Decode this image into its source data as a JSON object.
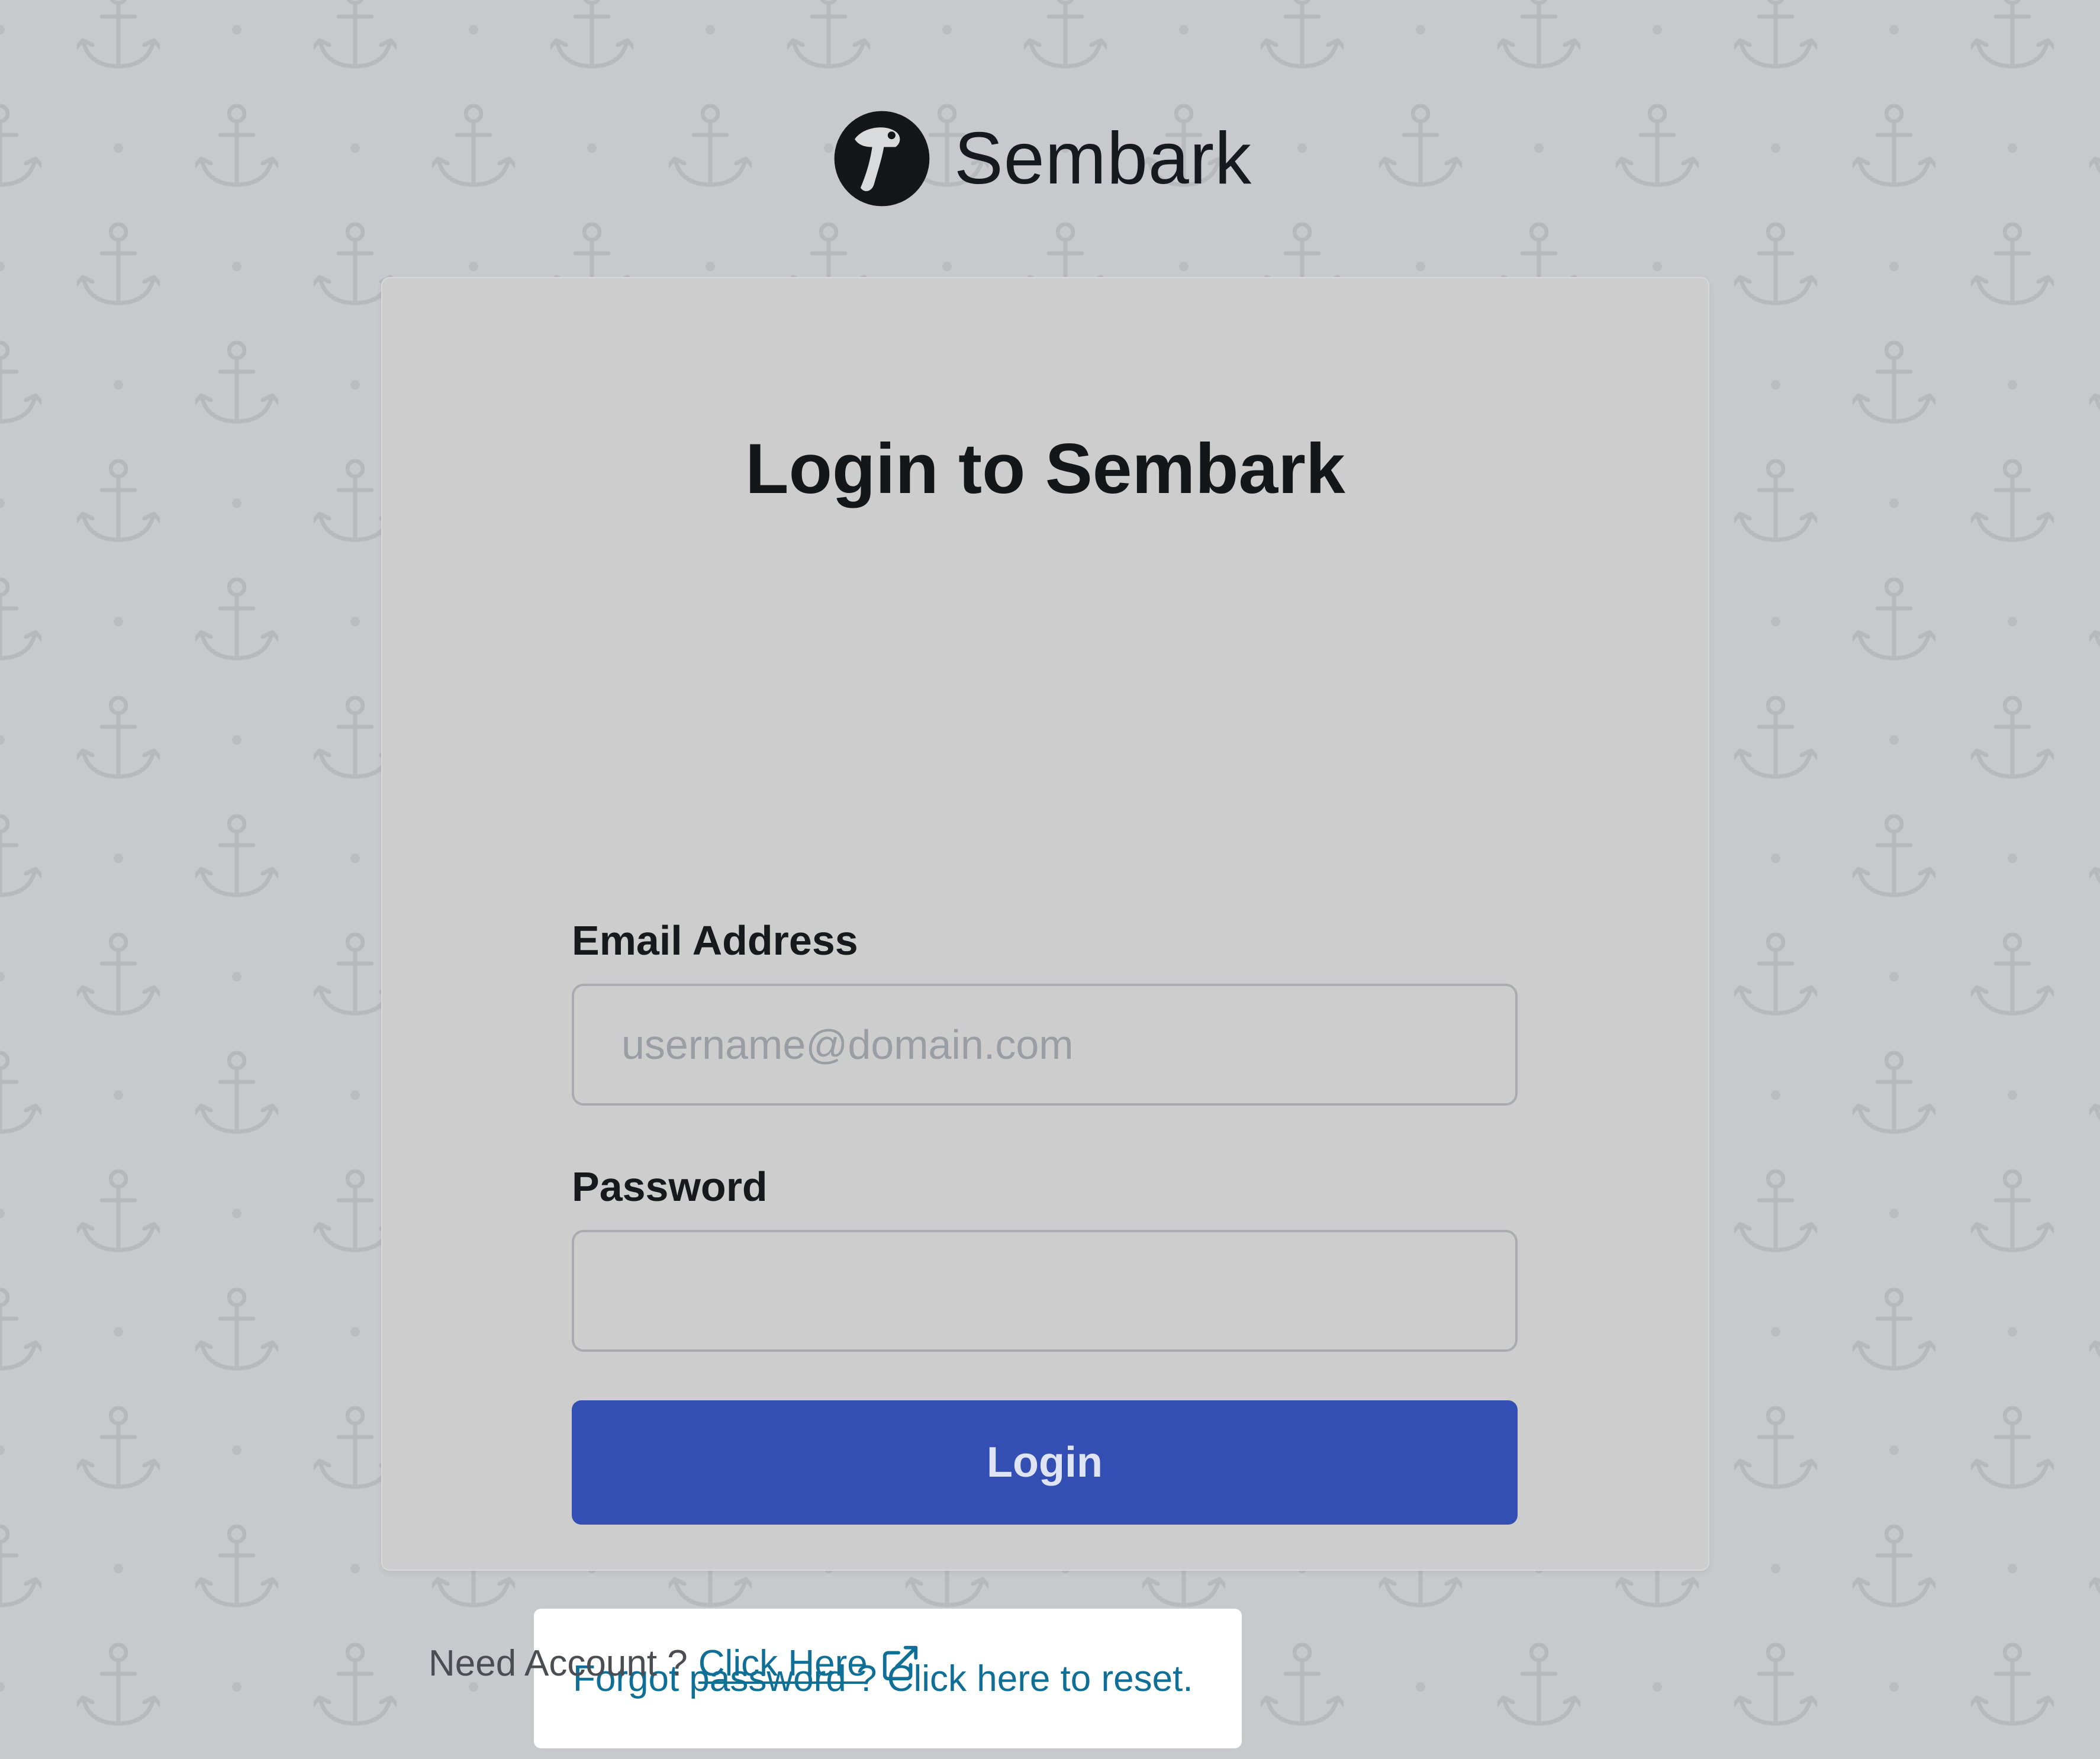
{
  "brand": {
    "name": "Sembark",
    "logo_icon": "sembark-logo-icon",
    "background_pattern_icon": "anchor-icon"
  },
  "login_card": {
    "title": "Login to Sembark",
    "email": {
      "label": "Email Address",
      "value": "",
      "placeholder": "username@domain.com"
    },
    "password": {
      "label": "Password",
      "value": "",
      "placeholder": ""
    },
    "login_button_label": "Login",
    "forgot_password_link": "Forgot password ? Click here to reset."
  },
  "footer": {
    "prompt": "Need Account ?",
    "link_label": "Click Here",
    "link_icon": "external-link-icon"
  },
  "colors": {
    "background": "#c8c9cc",
    "card": "#cdcdcd",
    "primary_button": "#334fb4",
    "link": "#0f6f96",
    "forgot_highlight": "#ffffff"
  }
}
